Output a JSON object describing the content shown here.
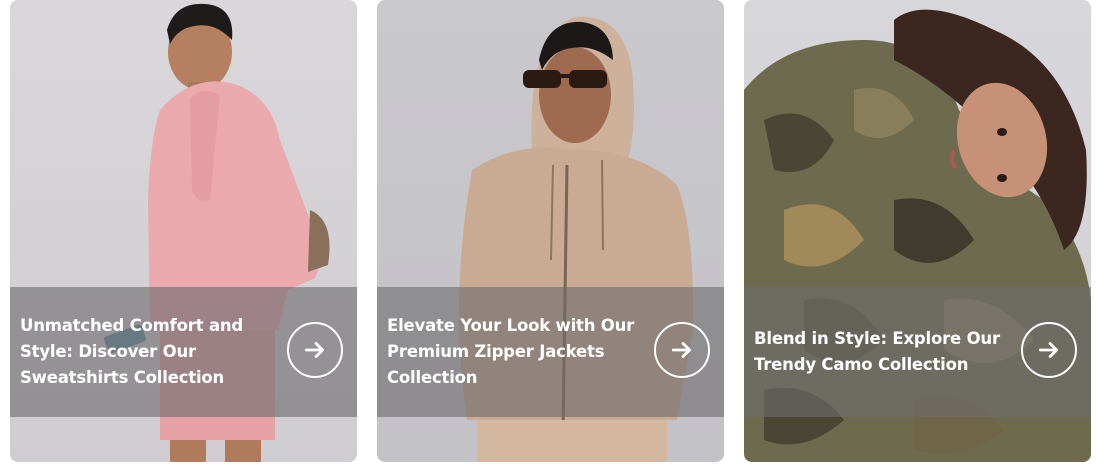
{
  "collections": [
    {
      "caption": "Unmatched Comfort and Style: Discover Our Sweatshirts Collection",
      "icon": "arrow-right-icon",
      "colors": {
        "garment": "#e9a9ad",
        "backdrop": "#d6d4d8"
      }
    },
    {
      "caption": "Elevate Your Look with Our Premium Zipper Jackets Collection",
      "icon": "arrow-right-icon",
      "colors": {
        "garment": "#c8ab92",
        "backdrop": "#c6c5ca"
      }
    },
    {
      "caption": "Blend in Style: Explore Our Trendy Camo Collection",
      "icon": "arrow-right-icon",
      "colors": {
        "garment": "#6e6a4e",
        "backdrop": "#d4d3d7"
      }
    }
  ]
}
